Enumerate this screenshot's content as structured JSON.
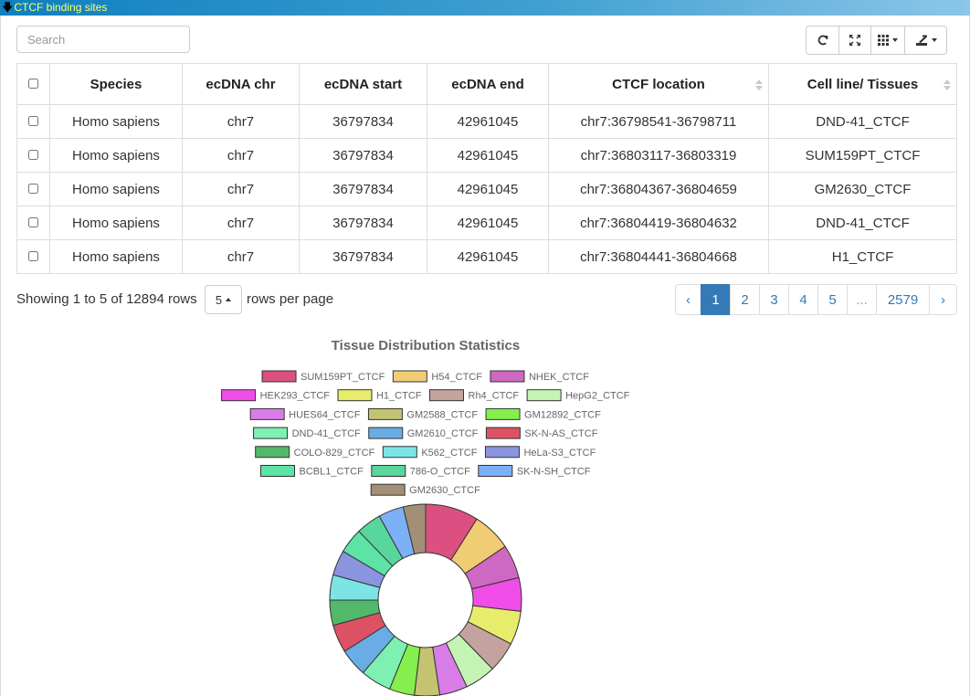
{
  "panel": {
    "title": "CTCF binding sites"
  },
  "search": {
    "placeholder": "Search"
  },
  "toolbar": {
    "icons": [
      "refresh-icon",
      "fullscreen-icon",
      "columns-icon",
      "export-icon"
    ]
  },
  "table": {
    "headers": [
      "Species",
      "ecDNA chr",
      "ecDNA start",
      "ecDNA end",
      "CTCF location",
      "Cell line/ Tissues"
    ],
    "rows": [
      [
        "Homo sapiens",
        "chr7",
        "36797834",
        "42961045",
        "chr7:36798541-36798711",
        "DND-41_CTCF"
      ],
      [
        "Homo sapiens",
        "chr7",
        "36797834",
        "42961045",
        "chr7:36803117-36803319",
        "SUM159PT_CTCF"
      ],
      [
        "Homo sapiens",
        "chr7",
        "36797834",
        "42961045",
        "chr7:36804367-36804659",
        "GM2630_CTCF"
      ],
      [
        "Homo sapiens",
        "chr7",
        "36797834",
        "42961045",
        "chr7:36804419-36804632",
        "DND-41_CTCF"
      ],
      [
        "Homo sapiens",
        "chr7",
        "36797834",
        "42961045",
        "chr7:36804441-36804668",
        "H1_CTCF"
      ]
    ]
  },
  "pagination": {
    "showing": "Showing 1 to 5 of 12894 rows",
    "page_size": "5",
    "rows_per_page": "rows per page",
    "prev": "‹",
    "pages": [
      "1",
      "2",
      "3",
      "4",
      "5",
      "...",
      "2579"
    ],
    "next": "›",
    "active": "1"
  },
  "chart_data": {
    "type": "pie",
    "title": "Tissue Distribution Statistics",
    "donut": true,
    "legend_position": "top",
    "categories": [
      "SUM159PT_CTCF",
      "H54_CTCF",
      "NHEK_CTCF",
      "HEK293_CTCF",
      "H1_CTCF",
      "Rh4_CTCF",
      "HepG2_CTCF",
      "HUES64_CTCF",
      "GM2588_CTCF",
      "GM12892_CTCF",
      "DND-41_CTCF",
      "GM2610_CTCF",
      "SK-N-AS_CTCF",
      "COLO-829_CTCF",
      "K562_CTCF",
      "HeLa-S3_CTCF",
      "BCBL1_CTCF",
      "786-O_CTCF",
      "SK-N-SH_CTCF",
      "GM2630_CTCF"
    ],
    "values": [
      9.5,
      7.0,
      6.0,
      6.0,
      6.0,
      5.5,
      5.5,
      5.0,
      4.5,
      4.5,
      5.5,
      5.0,
      5.0,
      4.5,
      4.5,
      4.5,
      4.5,
      4.5,
      4.5,
      4.0
    ],
    "colors": [
      "#dc5081",
      "#f0cc74",
      "#cf68c2",
      "#f04ce8",
      "#e8ec6c",
      "#c4a39f",
      "#c4f4b4",
      "#d87de8",
      "#c3c371",
      "#84ef4d",
      "#7ef0b2",
      "#68ade3",
      "#dc5264",
      "#52b96a",
      "#7de4e4",
      "#8b94de",
      "#5ce3a5",
      "#58d69c",
      "#7db1f7",
      "#a19077"
    ],
    "legend_rows": [
      [
        0,
        1,
        2
      ],
      [
        3,
        4,
        5,
        6
      ],
      [
        7,
        8,
        9
      ],
      [
        10,
        11,
        12
      ],
      [
        13,
        14,
        15
      ],
      [
        16,
        17,
        18
      ],
      [
        19
      ]
    ]
  }
}
